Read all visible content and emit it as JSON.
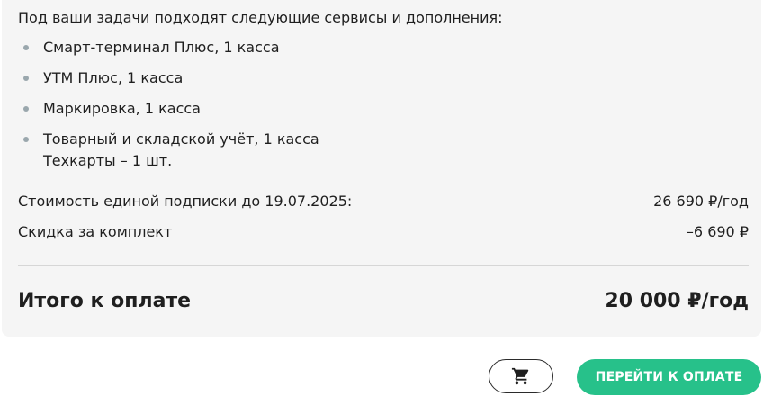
{
  "summary": {
    "intro": "Под ваши задачи подходят следующие сервисы и дополнения:",
    "services": [
      {
        "label": "Смарт-терминал Плюс, 1 касса"
      },
      {
        "label": "УТМ Плюс, 1 касса"
      },
      {
        "label": "Маркировка, 1 касса"
      },
      {
        "label": "Товарный и складской учёт, 1 касса",
        "sub": "Техкарты – 1 шт."
      }
    ],
    "cost_label": "Стоимость единой подписки до 19.07.2025:",
    "cost_value": "26 690 ₽/год",
    "discount_label": "Скидка за комплект",
    "discount_value": "–6 690 ₽",
    "total_label": "Итого к оплате",
    "total_value": "20 000 ₽/год"
  },
  "actions": {
    "cart_icon": "shopping-cart-icon",
    "pay_label": "ПЕРЕЙТИ К ОПЛАТЕ"
  },
  "colors": {
    "accent": "#27c18a",
    "card_bg": "#f5f5f5",
    "bullet": "#9aa7ad"
  }
}
